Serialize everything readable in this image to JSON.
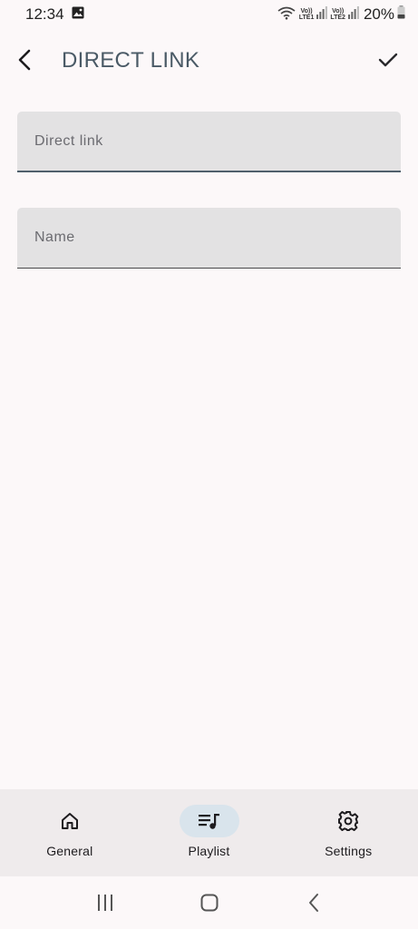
{
  "status_bar": {
    "time": "12:34",
    "battery": "20%",
    "sim1_top": "Vo))",
    "sim1_bottom": "LTE1",
    "sim2_top": "Vo))",
    "sim2_bottom": "LTE2",
    "icons": [
      "gallery-icon",
      "wifi-icon",
      "signal-icon",
      "battery-icon"
    ]
  },
  "header": {
    "title": "DIRECT LINK",
    "back_icon": "back-arrow-icon",
    "confirm_icon": "check-icon"
  },
  "form": {
    "direct_link": {
      "placeholder": "Direct link",
      "value": ""
    },
    "name": {
      "placeholder": "Name",
      "value": ""
    }
  },
  "bottom_nav": {
    "items": [
      {
        "label": "General",
        "icon": "home-icon",
        "active": false
      },
      {
        "label": "Playlist",
        "icon": "playlist-icon",
        "active": true
      },
      {
        "label": "Settings",
        "icon": "gear-icon",
        "active": false
      }
    ]
  },
  "system_nav": [
    "recents-icon",
    "home-icon",
    "back-icon"
  ],
  "colors": {
    "background": "#fcf8f9",
    "field_background": "#e3e2e3",
    "active_indicator": "#d9e4ec",
    "title": "#4a5a66"
  }
}
